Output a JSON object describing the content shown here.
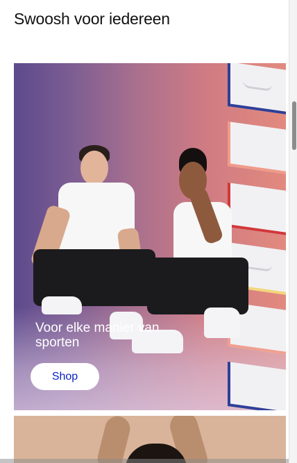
{
  "section": {
    "title": "Swoosh voor iedereen"
  },
  "hero": {
    "caption": "Voor elke manier van sporten",
    "cta_label": "Shop",
    "colors": {
      "gradient_start": "#5d4a8c",
      "gradient_end": "#e28a7e",
      "cta_text": "#0b22c4"
    }
  }
}
